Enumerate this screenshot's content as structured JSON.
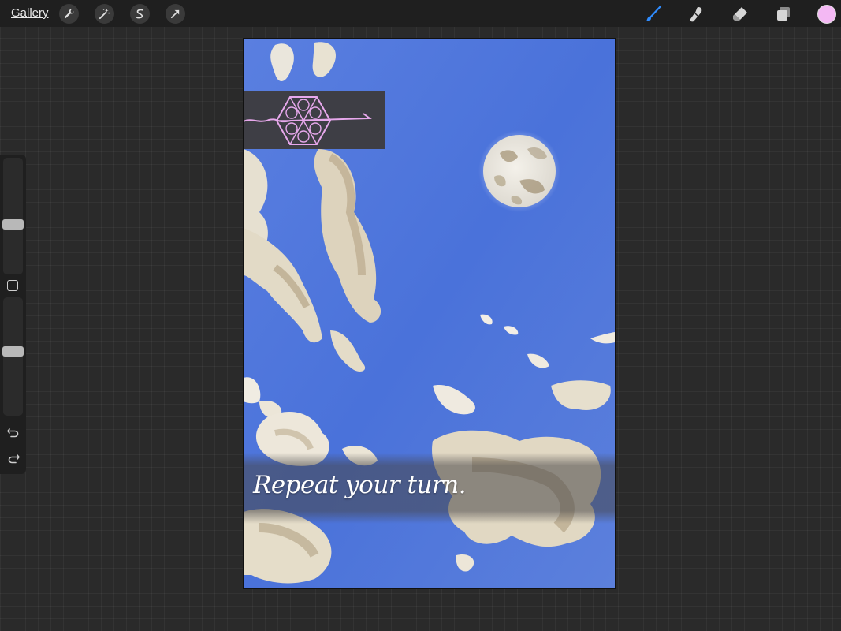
{
  "topbar": {
    "gallery_label": "Gallery",
    "left_tools": [
      "wrench-icon",
      "magic-wand-icon",
      "selection-icon",
      "transform-arrow-icon"
    ],
    "right_tools": [
      "brush-icon",
      "smudge-icon",
      "eraser-icon",
      "layers-icon"
    ],
    "current_color": "#f4b8f4",
    "active_tool_color": "#2f8cff"
  },
  "sidebar": {
    "brush_size_level": 0.42,
    "opacity_level": 0.55,
    "undo_icon": "undo-icon",
    "redo_icon": "redo-icon"
  },
  "canvas": {
    "caption": "Repeat your turn.",
    "sky_color": "#4f78dc",
    "ornament_color": "#e7a8ec",
    "banner_color": "#3d3b3c"
  }
}
